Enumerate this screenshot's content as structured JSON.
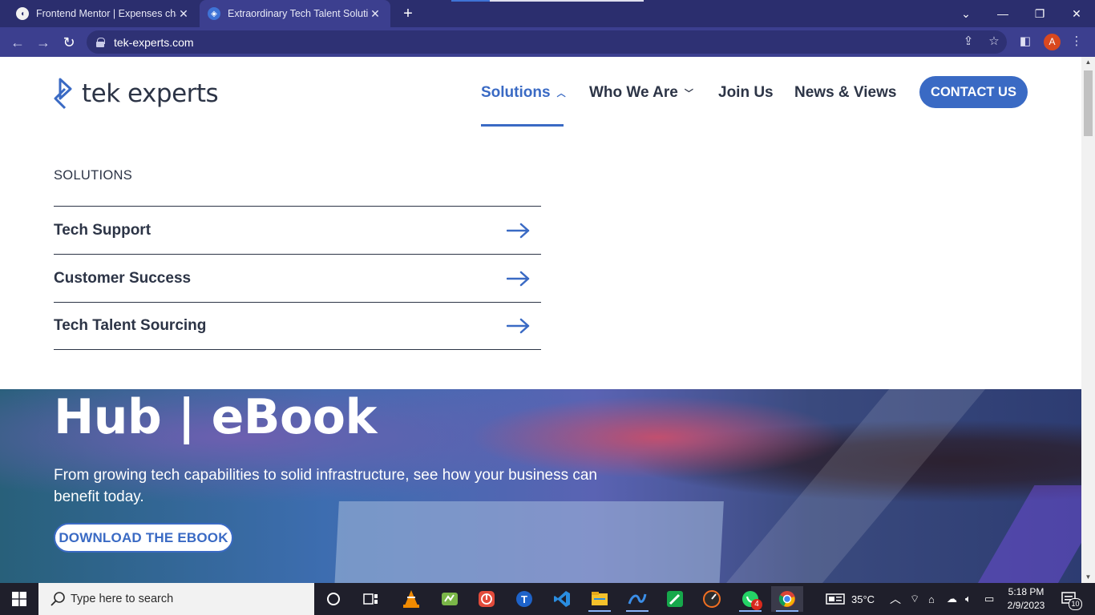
{
  "browser": {
    "tabs": [
      {
        "title": "Frontend Mentor | Expenses char",
        "favicon": "frontend-mentor-favicon",
        "active": false
      },
      {
        "title": "Extraordinary Tech Talent Solution",
        "favicon": "tek-experts-favicon",
        "active": true
      }
    ],
    "url": "tek-experts.com",
    "profile_initial": "A"
  },
  "site": {
    "logo_text": "tek experts",
    "nav": {
      "solutions": "Solutions",
      "who_we_are": "Who We Are",
      "join_us": "Join Us",
      "news_views": "News & Views",
      "contact": "CONTACT US"
    },
    "dropdown": {
      "title": "SOLUTIONS",
      "items": [
        "Tech Support",
        "Customer Success",
        "Tech Talent Sourcing"
      ]
    },
    "hero": {
      "title": "Hub | eBook",
      "subtitle": "From growing tech capabilities to solid infrastructure, see how your business can benefit today.",
      "button": "DOWNLOAD THE EBOOK"
    },
    "colors": {
      "accent": "#3a6ac4",
      "text": "#2c3446"
    }
  },
  "taskbar": {
    "search_placeholder": "Type here to search",
    "weather": "35°C",
    "time": "5:18 PM",
    "date": "2/9/2023",
    "notification_count": "10",
    "whatsapp_badge": "4"
  }
}
